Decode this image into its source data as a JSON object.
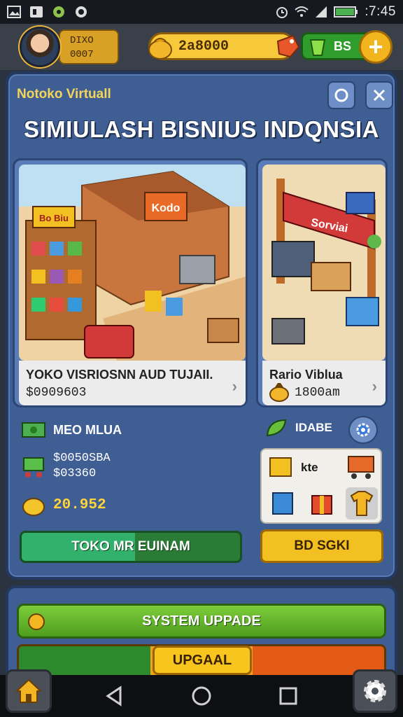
{
  "status_bar": {
    "time": ":7:45",
    "icons": [
      "photo-icon",
      "flipboard-icon",
      "game-icon",
      "camera-icon",
      "alarm-icon",
      "wifi-icon",
      "signal-icon",
      "battery-icon"
    ]
  },
  "hud": {
    "player_name": "DIXO",
    "player_level": "0007",
    "coins": "2a8000",
    "gems": "BS",
    "gems_plus": "+"
  },
  "panel": {
    "subtitle": "Notoko Virtuall",
    "title": "SIMIULASH BISNIUS INDQNSIA"
  },
  "cards": [
    {
      "title": "YOKO VISRIOSNN AUD TUJAII.",
      "value": "$0909603",
      "store_sign": "Kodo",
      "sign_text": "Bo Biu"
    },
    {
      "title": "Rario Viblua",
      "value": "1800am",
      "store_sign": "Sorviai"
    }
  ],
  "lower_left": {
    "label": "MEO MLUA",
    "line1": "$0050SBA",
    "line2": "$03360",
    "gold_value": "20.952",
    "button_label": "TOKO MR EUINAM"
  },
  "lower_right": {
    "label": "IDABE",
    "inv_label": "kte",
    "button_label": "BD SGKI"
  },
  "bottom": {
    "system_button": "SYSTEM UPPADE",
    "upgrade_button": "UPGAAL"
  },
  "colors": {
    "panel_blue": "#3f5f94",
    "accent_gold": "#f3c021",
    "accent_green": "#2f9d2b"
  }
}
